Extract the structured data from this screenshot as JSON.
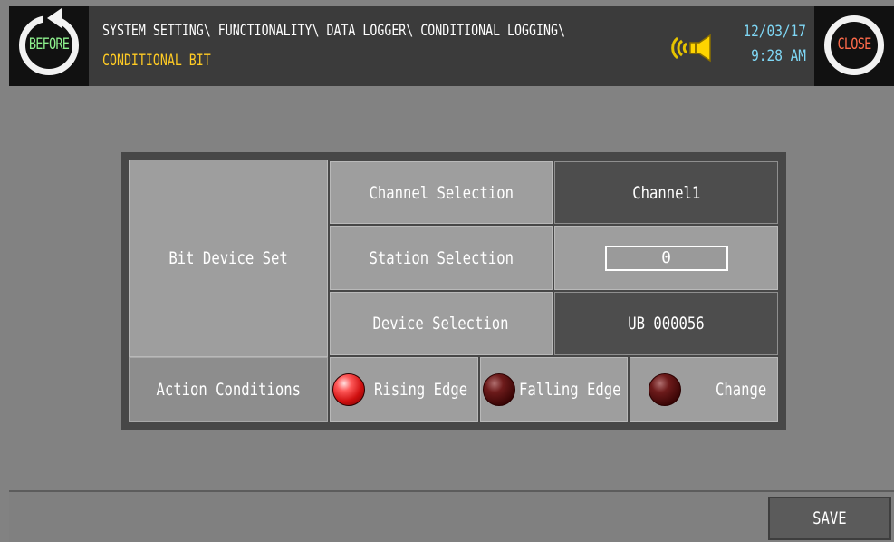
{
  "header": {
    "before_label": "BEFORE",
    "close_label": "CLOSE",
    "path": "SYSTEM SETTING\\ FUNCTIONALITY\\ DATA LOGGER\\ CONDITIONAL LOGGING\\",
    "page_title": "CONDITIONAL BIT",
    "date": "12/03/17",
    "time": "9:28 AM",
    "speaker_icon": "speaker-icon"
  },
  "form": {
    "group_label": "Bit Device Set",
    "channel_label": "Channel Selection",
    "channel_value": "Channel1",
    "station_label": "Station Selection",
    "station_value": "0",
    "device_label": "Device Selection",
    "device_value": "UB 000056",
    "action_label": "Action Conditions",
    "options": [
      {
        "label": "Rising Edge",
        "selected": true
      },
      {
        "label": "Falling Edge",
        "selected": false
      },
      {
        "label": "Change",
        "selected": false
      }
    ]
  },
  "footer": {
    "save_label": "SAVE"
  },
  "colors": {
    "background": "#828282",
    "header": "#3b3b3b",
    "path_text": "#ffffff",
    "title_text": "#ffcb24",
    "clock_text": "#7fd7f5",
    "before_text": "#8df08d",
    "close_text": "#ff6a4a",
    "led_on": "#d01010",
    "led_off": "#3a0505"
  }
}
